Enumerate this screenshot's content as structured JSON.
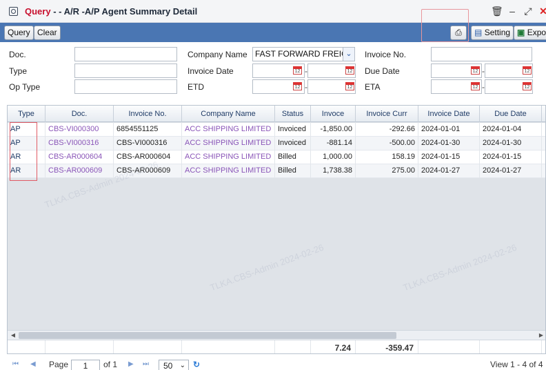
{
  "window": {
    "title_query": "Query",
    "title_rest": " - - A/R -A/P Agent Summary Detail"
  },
  "toolbar": {
    "query_label": "Query",
    "clear_label": "Clear",
    "setting_label": "Setting",
    "export_label": "Expor"
  },
  "filters": {
    "doc_label": "Doc.",
    "type_label": "Type",
    "op_type_label": "Op Type",
    "company_name_label": "Company Name",
    "company_name_value": "FAST FORWARD FREIG",
    "invoice_date_label": "Invoice Date",
    "etd_label": "ETD",
    "invoice_no_label": "Invoice No.",
    "due_date_label": "Due Date",
    "eta_label": "ETA",
    "range_dash": "-",
    "cal_text": "12"
  },
  "grid": {
    "columns": [
      "Type",
      "Doc.",
      "Invoice No.",
      "Company Name",
      "Status",
      "Invoce",
      "Invoice Curr",
      "Invoice Date",
      "Due Date"
    ],
    "rows": [
      [
        "AP",
        "CBS-VI000300",
        "6854551125",
        "ACC SHIPPING LIMITED",
        "Invoiced",
        "-1,850.00",
        "-292.66",
        "2024-01-01",
        "2024-01-04"
      ],
      [
        "AP",
        "CBS-VI000316",
        "CBS-VI000316",
        "ACC SHIPPING LIMITED",
        "Invoiced",
        "-881.14",
        "-500.00",
        "2024-01-30",
        "2024-01-30"
      ],
      [
        "AR",
        "CBS-AR000604",
        "CBS-AR000604",
        "ACC SHIPPING LIMITED",
        "Billed",
        "1,000.00",
        "158.19",
        "2024-01-15",
        "2024-01-15"
      ],
      [
        "AR",
        "CBS-AR000609",
        "CBS-AR000609",
        "ACC SHIPPING LIMITED",
        "Billed",
        "1,738.38",
        "275.00",
        "2024-01-27",
        "2024-01-27"
      ]
    ],
    "totals": {
      "invoce": "7.24",
      "invoice_curr": "-359.47"
    }
  },
  "pager": {
    "page_label": "Page",
    "page_value": "1",
    "of_label": "of 1",
    "page_size": "50",
    "view_text": "View 1 - 4 of 4"
  },
  "watermark": "TLKA.CBS-Admin 2024-02-26",
  "colors": {
    "toolbar": "#4a76b3",
    "link_purple": "#8a55b8",
    "title_red": "#c8102e",
    "highlight_box": "#e05a64"
  }
}
